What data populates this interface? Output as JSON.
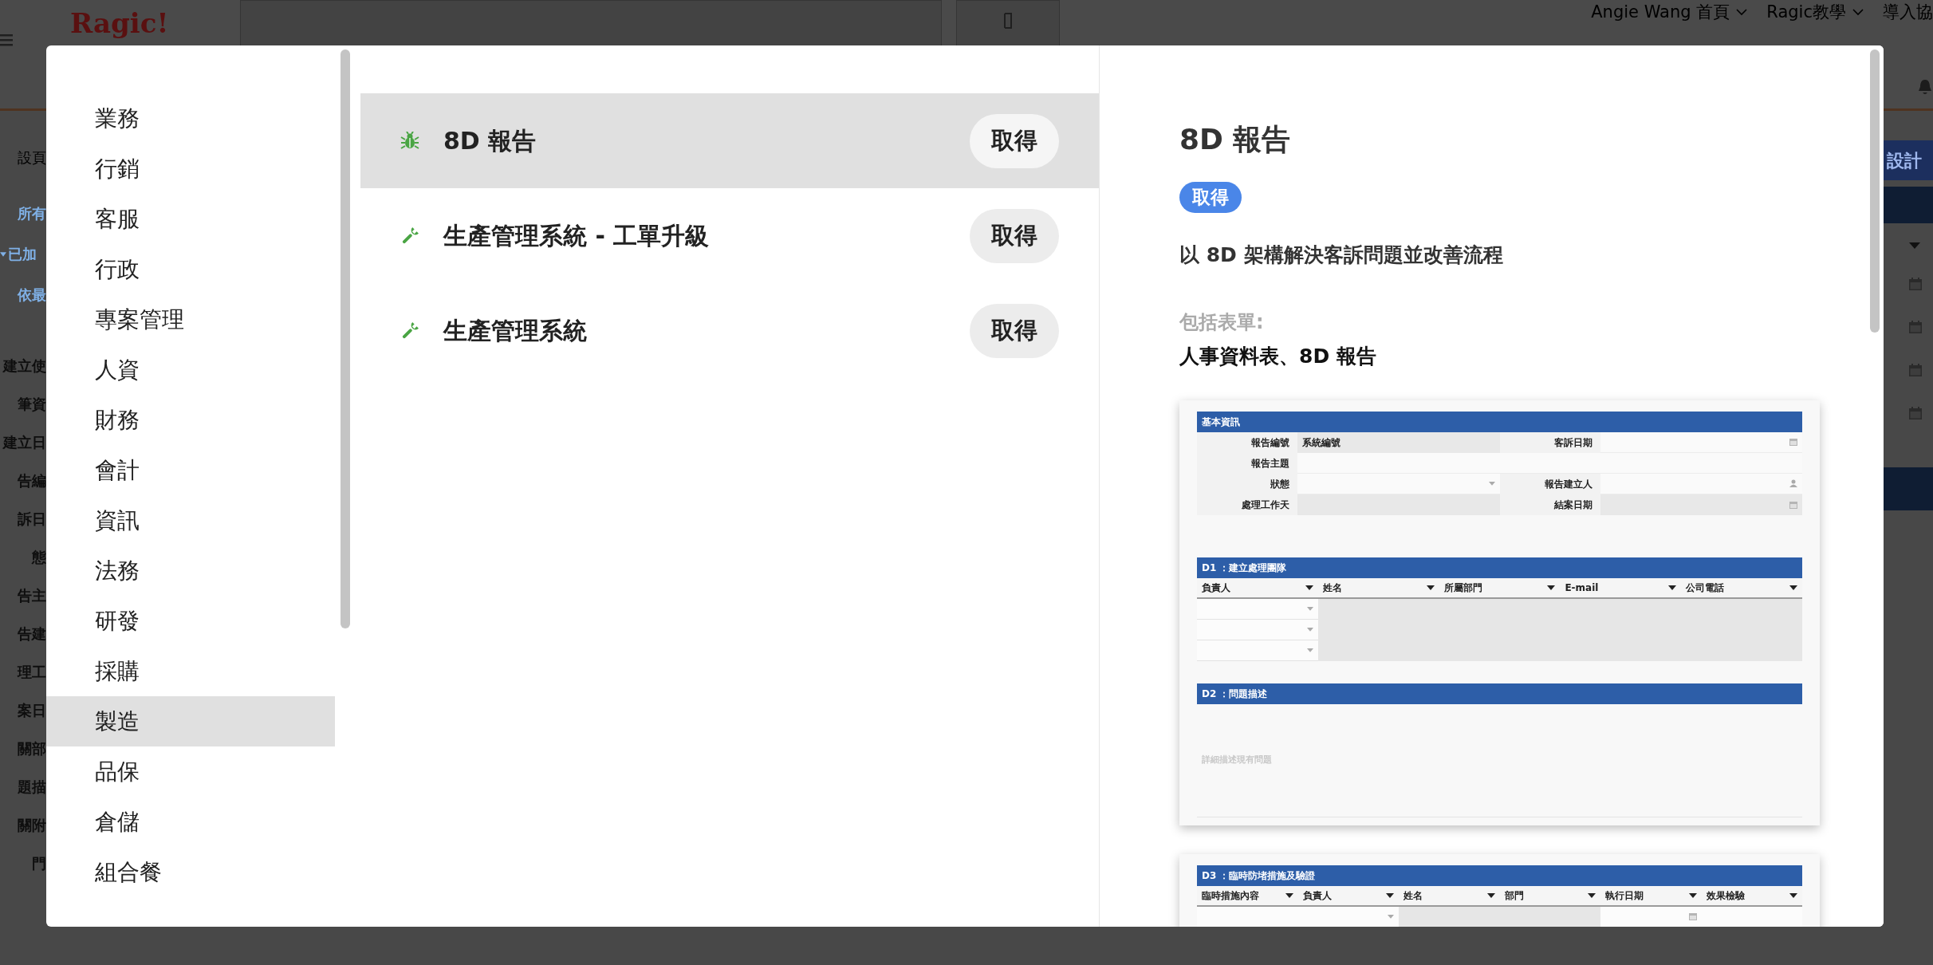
{
  "background": {
    "logo": "Ragic!",
    "top_menu": [
      {
        "label": "Angie Wang 首頁",
        "caret": true
      },
      {
        "label": "Ragic教學",
        "caret": true
      },
      {
        "label": "導入協",
        "caret": false
      }
    ],
    "side_fragments": [
      {
        "label": "設頁",
        "kind": "tab"
      },
      {
        "label": "所有",
        "kind": "link"
      },
      {
        "label": "已加",
        "kind": "toggle"
      },
      {
        "label": "依最",
        "kind": "link"
      },
      {
        "label": "建立使",
        "kind": "field"
      },
      {
        "label": "筆資",
        "kind": "field"
      },
      {
        "label": "建立日",
        "kind": "field"
      },
      {
        "label": "告編",
        "kind": "field"
      },
      {
        "label": "訴日",
        "kind": "field"
      },
      {
        "label": "態",
        "kind": "field"
      },
      {
        "label": "告主",
        "kind": "field"
      },
      {
        "label": "告建",
        "kind": "field"
      },
      {
        "label": "理工",
        "kind": "field"
      },
      {
        "label": "案日",
        "kind": "field"
      },
      {
        "label": "關部",
        "kind": "field"
      },
      {
        "label": "題描",
        "kind": "field"
      },
      {
        "label": "關附",
        "kind": "field"
      },
      {
        "label": "門",
        "kind": "field"
      }
    ],
    "right_button": "設計"
  },
  "modal": {
    "categories": [
      {
        "label": "業務",
        "selected": false
      },
      {
        "label": "行銷",
        "selected": false
      },
      {
        "label": "客服",
        "selected": false
      },
      {
        "label": "行政",
        "selected": false
      },
      {
        "label": "專案管理",
        "selected": false
      },
      {
        "label": "人資",
        "selected": false
      },
      {
        "label": "財務",
        "selected": false
      },
      {
        "label": "會計",
        "selected": false
      },
      {
        "label": "資訊",
        "selected": false
      },
      {
        "label": "法務",
        "selected": false
      },
      {
        "label": "研發",
        "selected": false
      },
      {
        "label": "採購",
        "selected": false
      },
      {
        "label": "製造",
        "selected": true
      },
      {
        "label": "品保",
        "selected": false
      },
      {
        "label": "倉儲",
        "selected": false
      },
      {
        "label": "組合餐",
        "selected": false
      }
    ],
    "templates": [
      {
        "name": "8D 報告",
        "kind": "bug",
        "button": "取得",
        "selected": true
      },
      {
        "name": "生產管理系統 - 工單升級",
        "kind": "wrench",
        "button": "取得",
        "selected": false
      },
      {
        "name": "生產管理系統",
        "kind": "wrench",
        "button": "取得",
        "selected": false
      }
    ],
    "detail": {
      "title": "8D 報告",
      "badge": "取得",
      "description": "以 8D 架構解決客訴問題並改善流程",
      "forms_label": "包括表單:",
      "forms": "人事資料表、8D 報告",
      "preview": [
        {
          "sections": [
            {
              "title": "基本資訊",
              "kind": "fields",
              "rows": [
                [
                  {
                    "label": "報告編號",
                    "value": "系統編號",
                    "kind": "shaded"
                  },
                  {
                    "label": "客訴日期",
                    "kind": "date"
                  }
                ],
                [
                  {
                    "label": "報告主題",
                    "kind": "text"
                  }
                ],
                [
                  {
                    "label": "狀態",
                    "kind": "select"
                  },
                  {
                    "label": "報告建立人",
                    "kind": "user"
                  }
                ],
                [
                  {
                    "label": "處理工作天",
                    "kind": "shaded"
                  },
                  {
                    "label": "結案日期",
                    "kind": "date-shaded"
                  }
                ]
              ]
            },
            {
              "title": "D1 ：建立處理團隊",
              "kind": "table",
              "columns": [
                {
                  "label": "負責人",
                  "kind": "select"
                },
                {
                  "label": "姓名",
                  "kind": "shaded"
                },
                {
                  "label": "所屬部門",
                  "kind": "shaded"
                },
                {
                  "label": "E-mail",
                  "kind": "shaded"
                },
                {
                  "label": "公司電話",
                  "kind": "shaded"
                }
              ]
            },
            {
              "title": "D2 ：問題描述",
              "kind": "textarea",
              "placeholder": "詳細描述現有問題"
            }
          ]
        },
        {
          "sections": [
            {
              "title": "D3 ：臨時防堵措施及驗證",
              "kind": "table",
              "columns": [
                {
                  "label": "臨時措施內容",
                  "kind": "text"
                },
                {
                  "label": "負責人",
                  "kind": "select"
                },
                {
                  "label": "姓名",
                  "kind": "shaded"
                },
                {
                  "label": "部門",
                  "kind": "shaded"
                },
                {
                  "label": "執行日期",
                  "kind": "date"
                },
                {
                  "label": "效果檢驗",
                  "kind": "text"
                }
              ]
            }
          ]
        }
      ]
    }
  }
}
